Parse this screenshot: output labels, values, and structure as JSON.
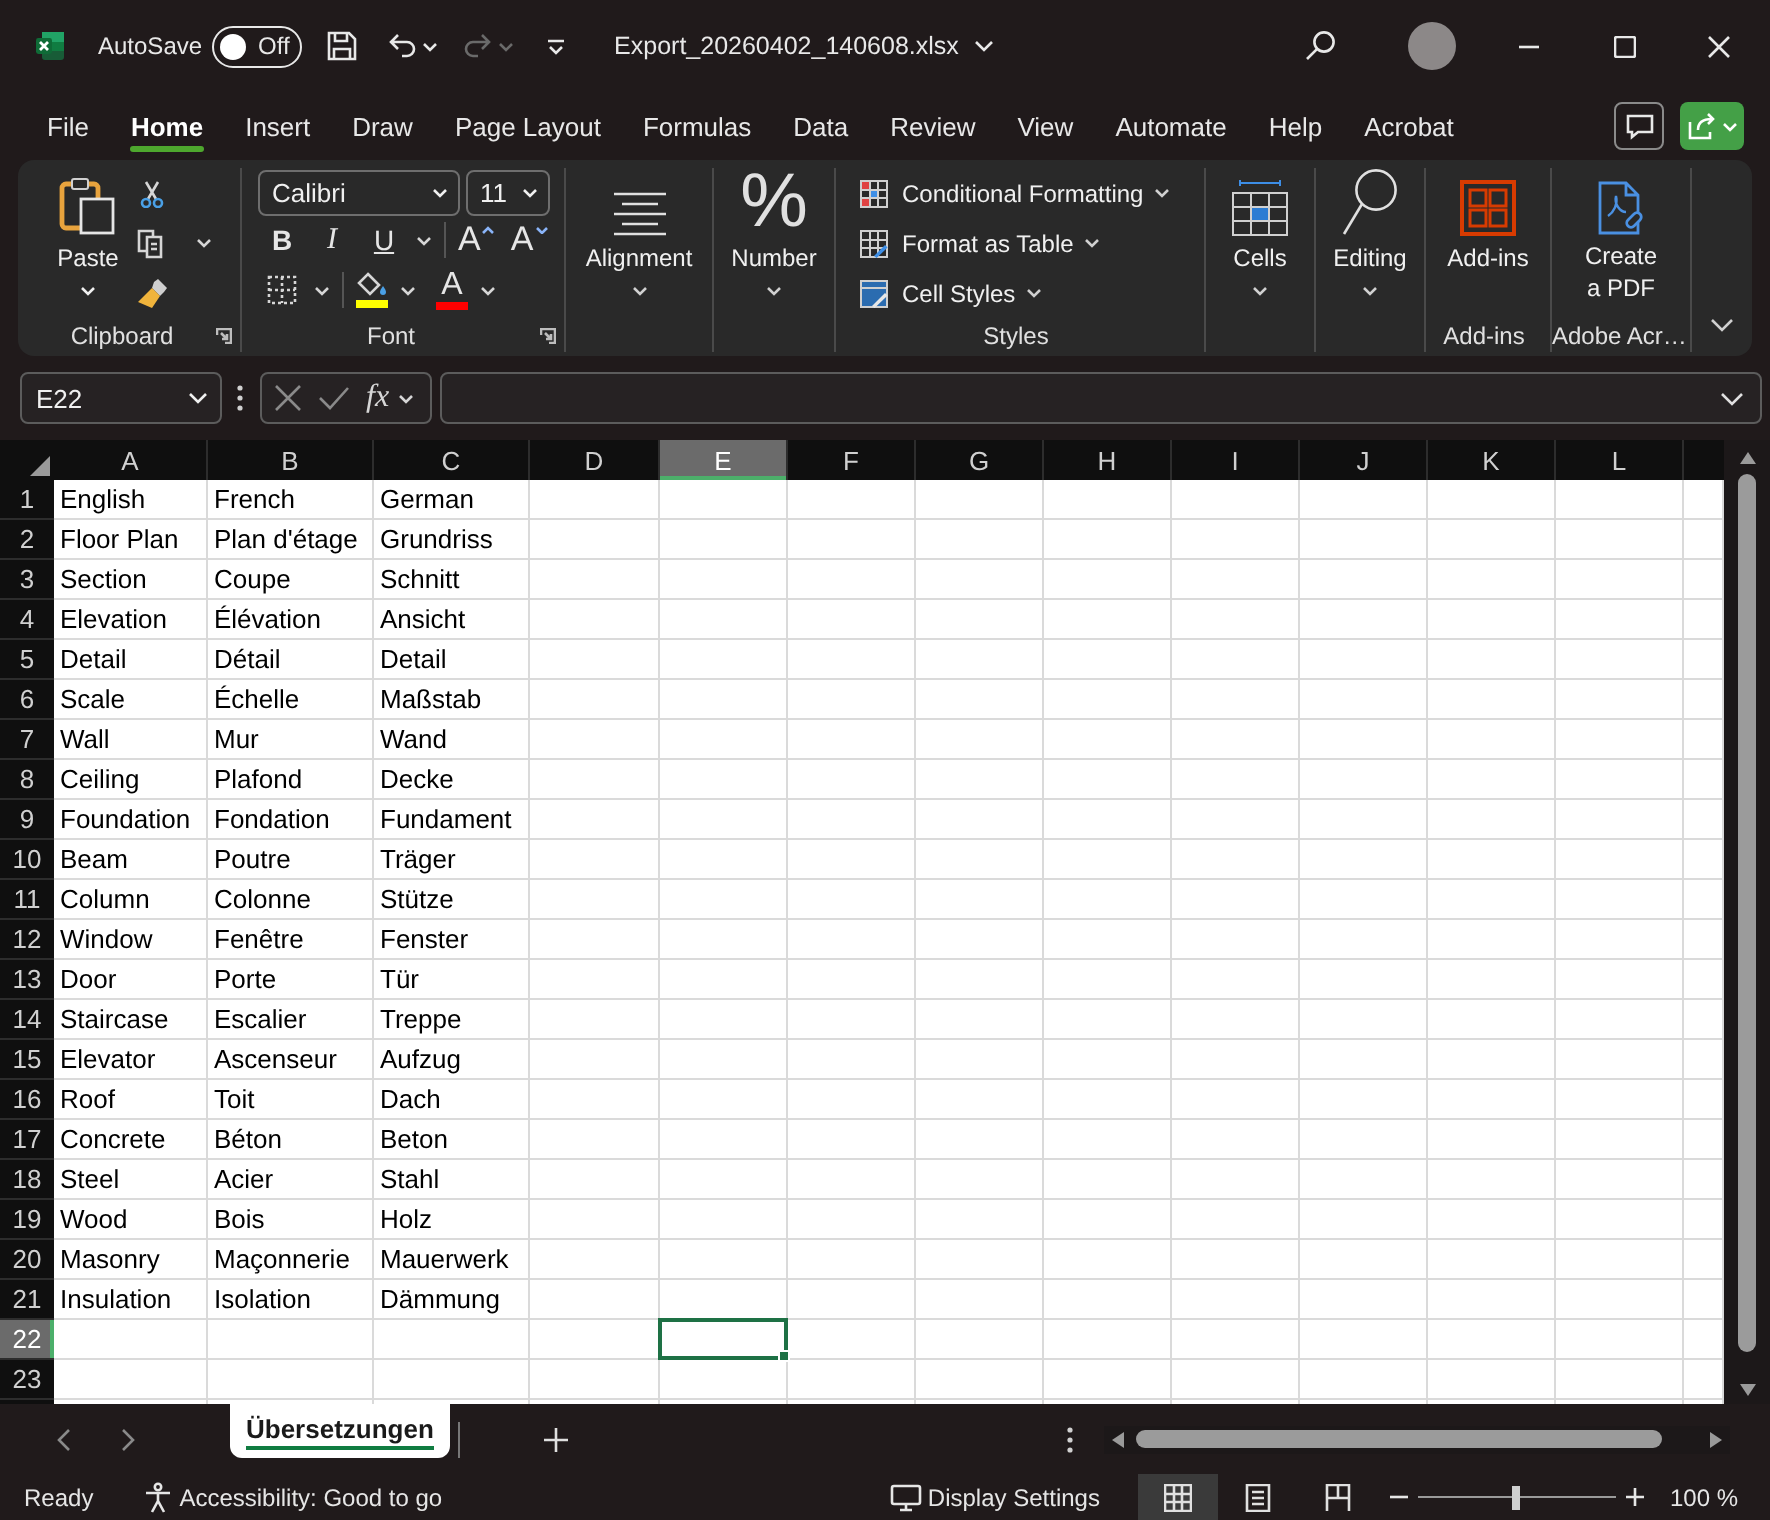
{
  "title_bar": {
    "autosave_label": "AutoSave",
    "autosave": {
      "on": false,
      "label": "Off"
    },
    "redo": {
      "disabled": true
    },
    "file_name": "Export_20260402_140608.xlsx"
  },
  "ribbon_tabs": [
    {
      "label": "File",
      "selected": false
    },
    {
      "label": "Home",
      "selected": true
    },
    {
      "label": "Insert",
      "selected": false
    },
    {
      "label": "Draw",
      "selected": false
    },
    {
      "label": "Page Layout",
      "selected": false
    },
    {
      "label": "Formulas",
      "selected": false
    },
    {
      "label": "Data",
      "selected": false
    },
    {
      "label": "Review",
      "selected": false
    },
    {
      "label": "View",
      "selected": false
    },
    {
      "label": "Automate",
      "selected": false
    },
    {
      "label": "Help",
      "selected": false
    },
    {
      "label": "Acrobat",
      "selected": false
    }
  ],
  "ribbon": {
    "clipboard": {
      "paste": "Paste",
      "label": "Clipboard"
    },
    "font": {
      "name": "Calibri",
      "size": "11",
      "bold": "B",
      "italic": "I",
      "underline": "U",
      "grow": "A",
      "shrink": "A",
      "fill_color": {
        "color": "#ffff00"
      },
      "font_color": {
        "label": "A",
        "color": "#ff0000"
      },
      "label": "Font"
    },
    "alignment": {
      "button": "Alignment"
    },
    "number": {
      "symbol": "%",
      "button": "Number"
    },
    "styles": {
      "commands": [
        {
          "kind": "conditional",
          "label": "Conditional Formatting"
        },
        {
          "kind": "table",
          "label": "Format as Table"
        },
        {
          "kind": "cell_styles",
          "label": "Cell Styles"
        }
      ],
      "label": "Styles"
    },
    "cells": {
      "button": "Cells"
    },
    "editing": {
      "button": "Editing"
    },
    "addins": {
      "button": "Add-ins",
      "label": "Add-ins"
    },
    "adobe": {
      "button": "Create a PDF",
      "label": "Adobe Acr…"
    }
  },
  "formula_bar": {
    "name_box": "E22",
    "function_button": "fx"
  },
  "sheet": {
    "columns": [
      {
        "label": "A",
        "selected": false
      },
      {
        "label": "B",
        "selected": false
      },
      {
        "label": "C",
        "selected": false
      },
      {
        "label": "D",
        "selected": false
      },
      {
        "label": "E",
        "selected": true
      },
      {
        "label": "F",
        "selected": false
      },
      {
        "label": "G",
        "selected": false
      },
      {
        "label": "H",
        "selected": false
      },
      {
        "label": "I",
        "selected": false
      },
      {
        "label": "J",
        "selected": false
      },
      {
        "label": "K",
        "selected": false
      },
      {
        "label": "L",
        "selected": false
      }
    ],
    "rows": [
      {
        "label": "1",
        "selected": false,
        "cells": [
          "English",
          "French",
          "German"
        ]
      },
      {
        "label": "2",
        "selected": false,
        "cells": [
          "Floor Plan",
          "Plan d'étage",
          "Grundriss"
        ]
      },
      {
        "label": "3",
        "selected": false,
        "cells": [
          "Section",
          "Coupe",
          "Schnitt"
        ]
      },
      {
        "label": "4",
        "selected": false,
        "cells": [
          "Elevation",
          "Élévation",
          "Ansicht"
        ]
      },
      {
        "label": "5",
        "selected": false,
        "cells": [
          "Detail",
          "Détail",
          "Detail"
        ]
      },
      {
        "label": "6",
        "selected": false,
        "cells": [
          "Scale",
          "Échelle",
          "Maßstab"
        ]
      },
      {
        "label": "7",
        "selected": false,
        "cells": [
          "Wall",
          "Mur",
          "Wand"
        ]
      },
      {
        "label": "8",
        "selected": false,
        "cells": [
          "Ceiling",
          "Plafond",
          "Decke"
        ]
      },
      {
        "label": "9",
        "selected": false,
        "cells": [
          "Foundation",
          "Fondation",
          "Fundament"
        ]
      },
      {
        "label": "10",
        "selected": false,
        "cells": [
          "Beam",
          "Poutre",
          "Träger"
        ]
      },
      {
        "label": "11",
        "selected": false,
        "cells": [
          "Column",
          "Colonne",
          "Stütze"
        ]
      },
      {
        "label": "12",
        "selected": false,
        "cells": [
          "Window",
          "Fenêtre",
          "Fenster"
        ]
      },
      {
        "label": "13",
        "selected": false,
        "cells": [
          "Door",
          "Porte",
          "Tür"
        ]
      },
      {
        "label": "14",
        "selected": false,
        "cells": [
          "Staircase",
          "Escalier",
          "Treppe"
        ]
      },
      {
        "label": "15",
        "selected": false,
        "cells": [
          "Elevator",
          "Ascenseur",
          "Aufzug"
        ]
      },
      {
        "label": "16",
        "selected": false,
        "cells": [
          "Roof",
          "Toit",
          "Dach"
        ]
      },
      {
        "label": "17",
        "selected": false,
        "cells": [
          "Concrete",
          "Béton",
          "Beton"
        ]
      },
      {
        "label": "18",
        "selected": false,
        "cells": [
          "Steel",
          "Acier",
          "Stahl"
        ]
      },
      {
        "label": "19",
        "selected": false,
        "cells": [
          "Wood",
          "Bois",
          "Holz"
        ]
      },
      {
        "label": "20",
        "selected": false,
        "cells": [
          "Masonry",
          "Maçonnerie",
          "Mauerwerk"
        ]
      },
      {
        "label": "21",
        "selected": false,
        "cells": [
          "Insulation",
          "Isolation",
          "Dämmung"
        ]
      },
      {
        "label": "22",
        "selected": true
      },
      {
        "label": "23",
        "selected": false
      }
    ]
  },
  "sheet_tabs": [
    {
      "label": "Übersetzungen",
      "selected": true
    }
  ],
  "status_bar": {
    "mode": "Ready",
    "accessibility": "Accessibility: Good to go",
    "display_settings": "Display Settings",
    "views": [
      {
        "kind": "normal",
        "selected": true
      },
      {
        "kind": "page_layout",
        "selected": false
      },
      {
        "kind": "page_break",
        "selected": false
      }
    ],
    "zoom": {
      "level": 0.5,
      "label": "100 %"
    }
  }
}
